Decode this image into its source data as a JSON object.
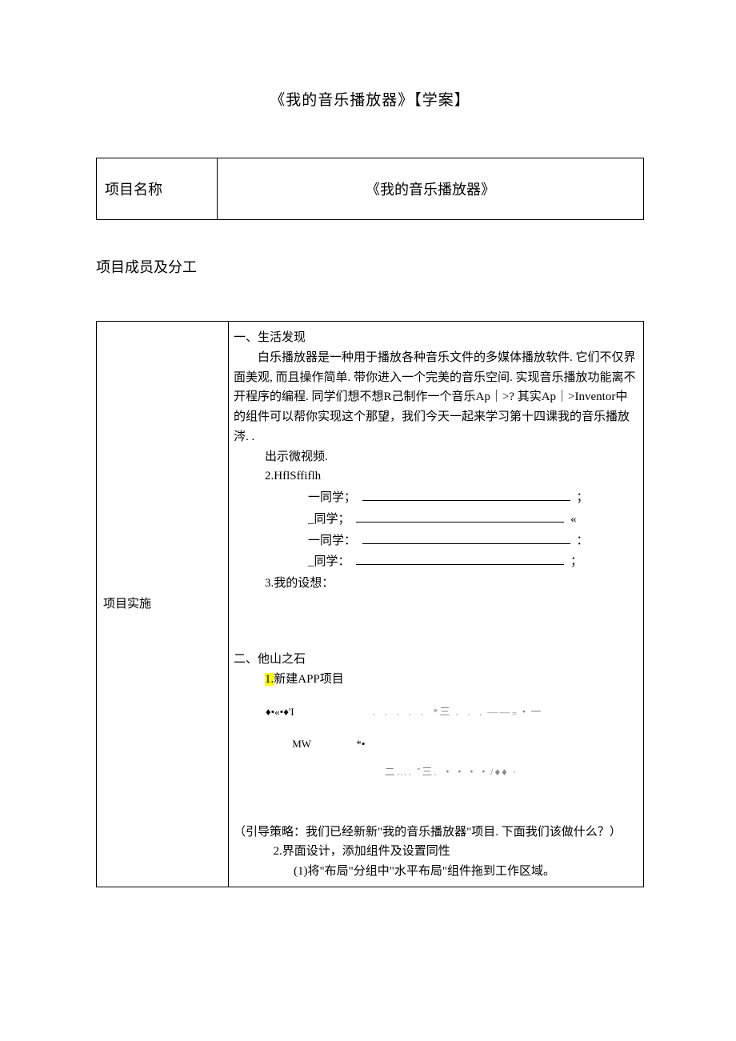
{
  "doc": {
    "title": "《我的音乐播放器》【学案】"
  },
  "projectName": {
    "label": "项目名称",
    "value": "《我的音乐播放器》"
  },
  "membersHeading": "项目成员及分工",
  "impl": {
    "leftLabel": "项目实施",
    "section1": {
      "heading": "一、生活发现",
      "para": "白乐播放器是一种用于播放各种音乐文件的多媒体播放软件. 它们不仅界面美观, 而且操作简单. 带你进入一个完美的音乐空间. 实现音乐播放功能离不开程序的编程. 同学们想不想R己制作一个音乐Ap｜>? 其实Ap｜>Inventor中的组件可以帮你实现这个那望，我们今天一起来学习第十四课我的音乐播放涔. .",
      "showVideo": "出示微视频.",
      "item2": "2.HflSffiflh",
      "s1": "一同学；",
      "s1_end": "；",
      "s2": "_同学；",
      "s2_end": "«",
      "s3": "一同学：",
      "s3_end": "：",
      "s4": "_同学：",
      "s4_end": "；",
      "item3": "3.我的设想："
    },
    "section2": {
      "heading": "二、他山之石",
      "step1_prefix": "1.",
      "step1_text": "新建APP项目",
      "fig_a": "♦•«•♦'I",
      "fig_mid": "﹒﹒﹒﹒﹒     *三﹒﹒﹒——₌・一",
      "fig_b_left": "MW",
      "fig_b_right": "*•",
      "fig_c": "二…. ˆ三. ・・・・/♦♦ ·",
      "guide": "（引导策略：我们已经新新\"我的音乐播放器\"项目. 下面我们该做什么？）",
      "step2": "2.界面设计，添加组件及设置同性",
      "step2_1": "(1)将\"布局\"分组中\"水平布局\"组件拖到工作区域。"
    }
  }
}
